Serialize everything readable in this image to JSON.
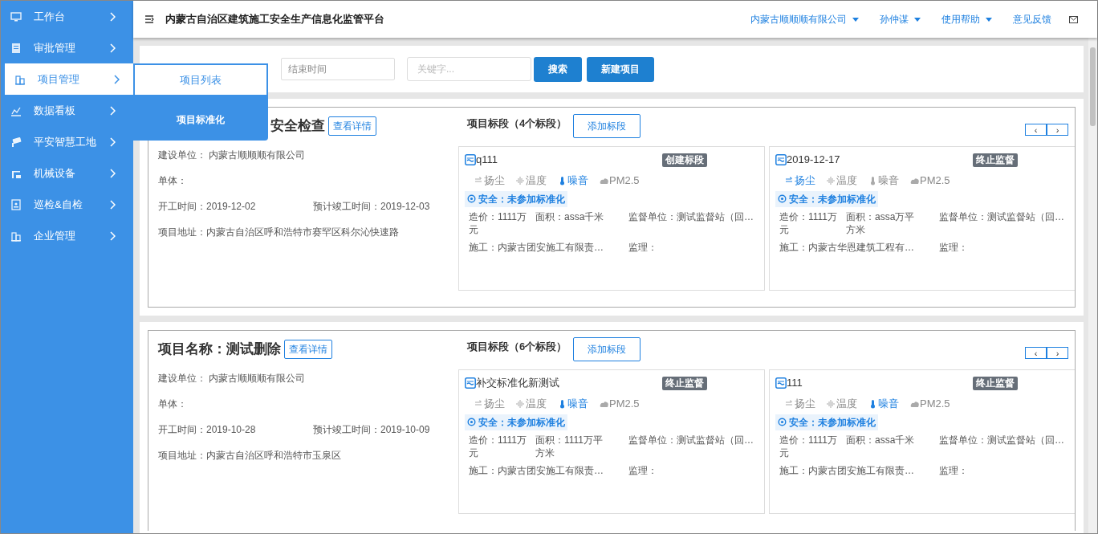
{
  "sidebar": {
    "items": [
      {
        "label": "工作台",
        "selected": false
      },
      {
        "label": "审批管理",
        "selected": false
      },
      {
        "label": "项目管理",
        "selected": true
      },
      {
        "label": "数据看板",
        "selected": false
      },
      {
        "label": "平安智慧工地",
        "selected": false
      },
      {
        "label": "机械设备",
        "selected": false
      },
      {
        "label": "巡检&自检",
        "selected": false
      },
      {
        "label": "企业管理",
        "selected": false
      }
    ],
    "submenu": [
      {
        "label": "项目列表",
        "selected": true
      },
      {
        "label": "项目标准化",
        "selected": false
      }
    ]
  },
  "header": {
    "title": "内蒙古自治区建筑施工安全生产信息化监管平台",
    "menus": [
      {
        "label": "内蒙古顺顺顺有限公司",
        "dropdown": true
      },
      {
        "label": "孙仲谋",
        "dropdown": true
      },
      {
        "label": "使用帮助",
        "dropdown": true
      },
      {
        "label": "意见反馈",
        "dropdown": false
      }
    ]
  },
  "filters": {
    "end_time": {
      "placeholder": "结束时间"
    },
    "keyword": {
      "placeholder": "关键字..."
    },
    "buttons": [
      "搜索",
      "新建项目"
    ]
  },
  "projects": [
    {
      "title": "安全检查",
      "detail_button": "查看详情",
      "builder": "建设单位：  内蒙古顺顺顺有限公司",
      "unit": "单体：",
      "start": "开工时间：2019-12-02",
      "end": "预计竣工时间：2019-12-03",
      "address": "项目地址：内蒙古自治区呼和浩特市赛罕区科尔沁快速路",
      "segments_title": "项目标段（4个标段）",
      "add_button": "添加标段",
      "pager": [
        "‹",
        "›"
      ],
      "segments": [
        {
          "name": "q111",
          "status": "创建标段",
          "sensors": [
            {
              "kind": "dust",
              "label": "扬尘",
              "on": false
            },
            {
              "kind": "temperature",
              "label": "温度",
              "on": false
            },
            {
              "kind": "noise",
              "label": "噪音",
              "on": true
            },
            {
              "kind": "pm",
              "label": "PM2.5",
              "on": false
            }
          ],
          "safety": "安全：未参加标准化",
          "cost": "造价：1111万元",
          "area": "面积：assa千米",
          "supervisor": "监督单位：测试监督站（回…",
          "construction": "施工：内蒙古团安施工有限责…",
          "monitor": "监理："
        },
        {
          "name": "2019-12-17",
          "status": "终止监督",
          "sensors": [
            {
              "kind": "dust",
              "label": "扬尘",
              "on": true
            },
            {
              "kind": "temperature",
              "label": "温度",
              "on": false
            },
            {
              "kind": "noise",
              "label": "噪音",
              "on": false
            },
            {
              "kind": "pm",
              "label": "PM2.5",
              "on": false
            }
          ],
          "safety": "安全：未参加标准化",
          "cost": "造价：1111万元",
          "area": "面积：assa万平方米",
          "supervisor": "监督单位：测试监督站（回…",
          "construction": "施工：内蒙古华恩建筑工程有…",
          "monitor": "监理："
        }
      ]
    },
    {
      "title": "项目名称：测试删除",
      "detail_button": "查看详情",
      "builder": "建设单位：  内蒙古顺顺顺有限公司",
      "unit": "单体：",
      "start": "开工时间：2019-10-28",
      "end": "预计竣工时间：2019-10-09",
      "address": "项目地址：内蒙古自治区呼和浩特市玉泉区",
      "segments_title": "项目标段（6个标段）",
      "add_button": "添加标段",
      "pager": [
        "‹",
        "›"
      ],
      "segments": [
        {
          "name": "补交标准化新测试",
          "status": "终止监督",
          "sensors": [
            {
              "kind": "dust",
              "label": "扬尘",
              "on": false
            },
            {
              "kind": "temperature",
              "label": "温度",
              "on": false
            },
            {
              "kind": "noise",
              "label": "噪音",
              "on": true
            },
            {
              "kind": "pm",
              "label": "PM2.5",
              "on": false
            }
          ],
          "safety": "安全：未参加标准化",
          "cost": "造价：1111万元",
          "area": "面积：1111万平方米",
          "supervisor": "监督单位：测试监督站（回…",
          "construction": "施工：内蒙古团安施工有限责…",
          "monitor": "监理："
        },
        {
          "name": "111",
          "status": "终止监督",
          "sensors": [
            {
              "kind": "dust",
              "label": "扬尘",
              "on": false
            },
            {
              "kind": "temperature",
              "label": "温度",
              "on": false
            },
            {
              "kind": "noise",
              "label": "噪音",
              "on": true
            },
            {
              "kind": "pm",
              "label": "PM2.5",
              "on": false
            }
          ],
          "safety": "安全：未参加标准化",
          "cost": "造价：1111万元",
          "area": "面积：assa千米",
          "supervisor": "监督单位：测试监督站（回…",
          "construction": "施工：内蒙古团安施工有限责…",
          "monitor": "监理："
        }
      ]
    }
  ]
}
